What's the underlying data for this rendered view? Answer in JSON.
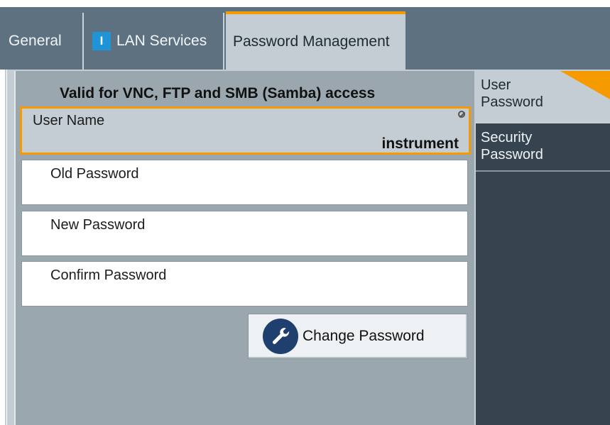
{
  "tabs": [
    {
      "label": "General",
      "active": false
    },
    {
      "label": "LAN Services",
      "active": false,
      "badge": "I"
    },
    {
      "label": "Password Management",
      "active": true
    }
  ],
  "section": {
    "title": "Valid for VNC, FTP and SMB (Samba) access"
  },
  "fields": {
    "username": {
      "label": "User Name",
      "value": "instrument",
      "locked": true
    },
    "old_password": {
      "label": "Old Password",
      "value": ""
    },
    "new_password": {
      "label": "New Password",
      "value": ""
    },
    "confirm_password": {
      "label": "Confirm Password",
      "value": ""
    }
  },
  "buttons": {
    "change_password": "Change Password"
  },
  "side_menu": [
    {
      "label_line1": "User",
      "label_line2": "Password",
      "active": true
    },
    {
      "label_line1": "Security",
      "label_line2": "Password",
      "active": false
    }
  ],
  "colors": {
    "accent": "#f59a00",
    "tabbar": "#5d7180",
    "panel": "#c3cdd3",
    "content": "#9ba7af",
    "sidebar": "#35444f",
    "info_badge": "#1f94d6",
    "wrench_circle": "#1f3f6e"
  },
  "icons": {
    "info_badge": "info-icon",
    "username_lock": "lock-icon",
    "change_password": "wrench-icon"
  }
}
